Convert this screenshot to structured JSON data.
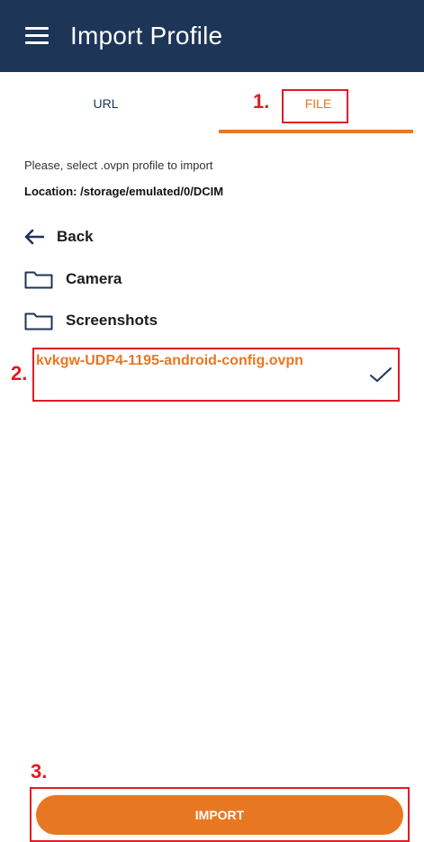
{
  "app_bar": {
    "title": "Import Profile",
    "icon": "menu-icon"
  },
  "tabs": [
    {
      "label": "URL",
      "selected": false
    },
    {
      "label": "FILE",
      "selected": true
    }
  ],
  "instruction": "Please, select .ovpn profile to import",
  "location": "Location: /storage/emulated/0/DCIM",
  "nav": {
    "back_label": "Back",
    "back_icon": "arrow-left-icon"
  },
  "folders": [
    {
      "label": "Camera",
      "icon": "folder-icon"
    },
    {
      "label": "Screenshots",
      "icon": "folder-icon"
    }
  ],
  "file": {
    "name": "kvkgw-UDP4-1195-android-config.ovpn",
    "selected": true,
    "icon": "checkmark-icon"
  },
  "import_button": {
    "label": "IMPORT"
  },
  "annotations": [
    "1.",
    "2.",
    "3."
  ],
  "colors": {
    "app_bar": "#1d3557",
    "accent": "#e87722",
    "annotation": "#e01c24"
  }
}
